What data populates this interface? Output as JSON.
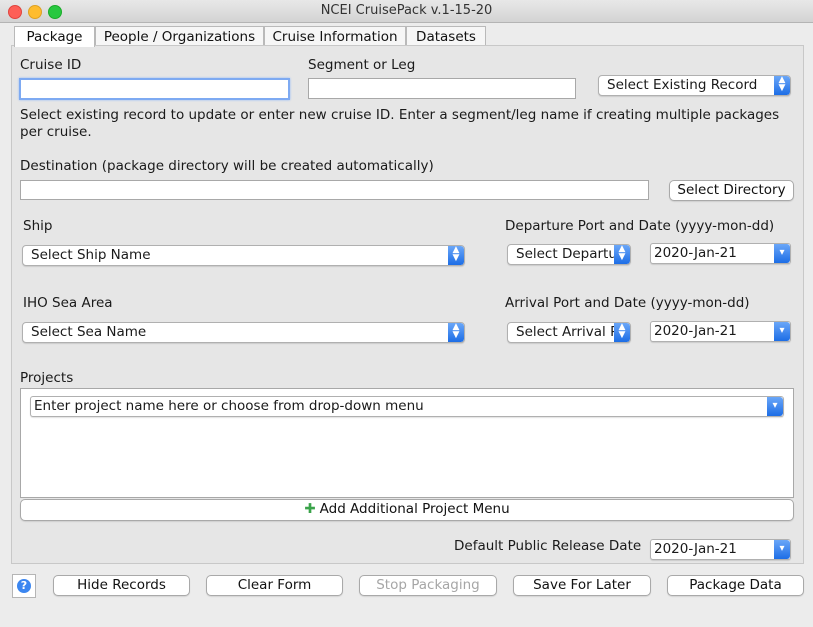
{
  "window": {
    "title": "NCEI CruisePack v.1-15-20"
  },
  "tabs": [
    {
      "label": "Package",
      "active": true
    },
    {
      "label": "People / Organizations",
      "active": false
    },
    {
      "label": "Cruise Information",
      "active": false
    },
    {
      "label": "Datasets",
      "active": false
    }
  ],
  "cruise": {
    "cruise_id_label": "Cruise ID",
    "cruise_id_value": "",
    "segment_label": "Segment or Leg",
    "segment_value": "",
    "existing_record": "Select Existing Record",
    "hint": "Select existing record to update or enter new cruise ID. Enter a segment/leg name if creating multiple packages per cruise."
  },
  "destination": {
    "label": "Destination (package directory will be created automatically)",
    "value": "",
    "button": "Select Directory"
  },
  "ship": {
    "label": "Ship",
    "selected": "Select Ship Name"
  },
  "departure": {
    "label": "Departure Port and Date (yyyy-mon-dd)",
    "port": "Select Departu",
    "date": "2020-Jan-21"
  },
  "sea": {
    "label": "IHO Sea Area",
    "selected": "Select Sea Name"
  },
  "arrival": {
    "label": "Arrival Port and Date (yyyy-mon-dd)",
    "port": "Select Arrival P",
    "date": "2020-Jan-21"
  },
  "projects": {
    "label": "Projects",
    "placeholder": "Enter project name here or choose from drop-down menu",
    "add_button": "Add Additional Project Menu"
  },
  "release": {
    "label": "Default Public Release Date",
    "date": "2020-Jan-21"
  },
  "footer": {
    "help": "?",
    "buttons": [
      "Hide Records",
      "Clear Form",
      "Stop Packaging",
      "Save For Later",
      "Package Data"
    ]
  },
  "colors": {
    "accent": "#1d6de6",
    "focus": "#7eaaf2",
    "add_icon": "#3aa34a"
  }
}
